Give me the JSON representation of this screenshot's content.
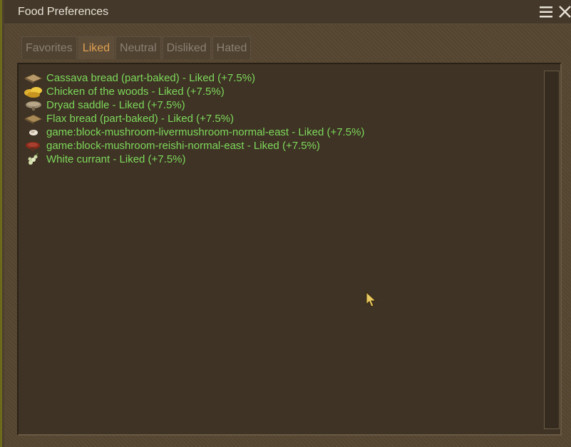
{
  "window": {
    "title": "Food Preferences"
  },
  "tabs": [
    {
      "label": "Favorites",
      "active": false
    },
    {
      "label": "Liked",
      "active": true
    },
    {
      "label": "Neutral",
      "active": false
    },
    {
      "label": "Disliked",
      "active": false
    },
    {
      "label": "Hated",
      "active": false
    }
  ],
  "items": [
    {
      "icon": "bread-icon",
      "label": "Cassava bread (part-baked) - Liked (+7.5%)"
    },
    {
      "icon": "chicken-of-the-woods-icon",
      "label": "Chicken of the woods - Liked (+7.5%)"
    },
    {
      "icon": "dryad-saddle-icon",
      "label": "Dryad saddle - Liked (+7.5%)"
    },
    {
      "icon": "bread-icon",
      "label": "Flax bread (part-baked) - Liked (+7.5%)"
    },
    {
      "icon": "livermushroom-icon",
      "label": "game:block-mushroom-livermushroom-normal-east - Liked (+7.5%)"
    },
    {
      "icon": "reishi-mushroom-icon",
      "label": "game:block-mushroom-reishi-normal-east - Liked (+7.5%)"
    },
    {
      "icon": "white-currant-icon",
      "label": "White currant - Liked (+7.5%)"
    }
  ],
  "colors": {
    "liked_text": "#7ed85c",
    "active_tab": "#e0a050"
  }
}
